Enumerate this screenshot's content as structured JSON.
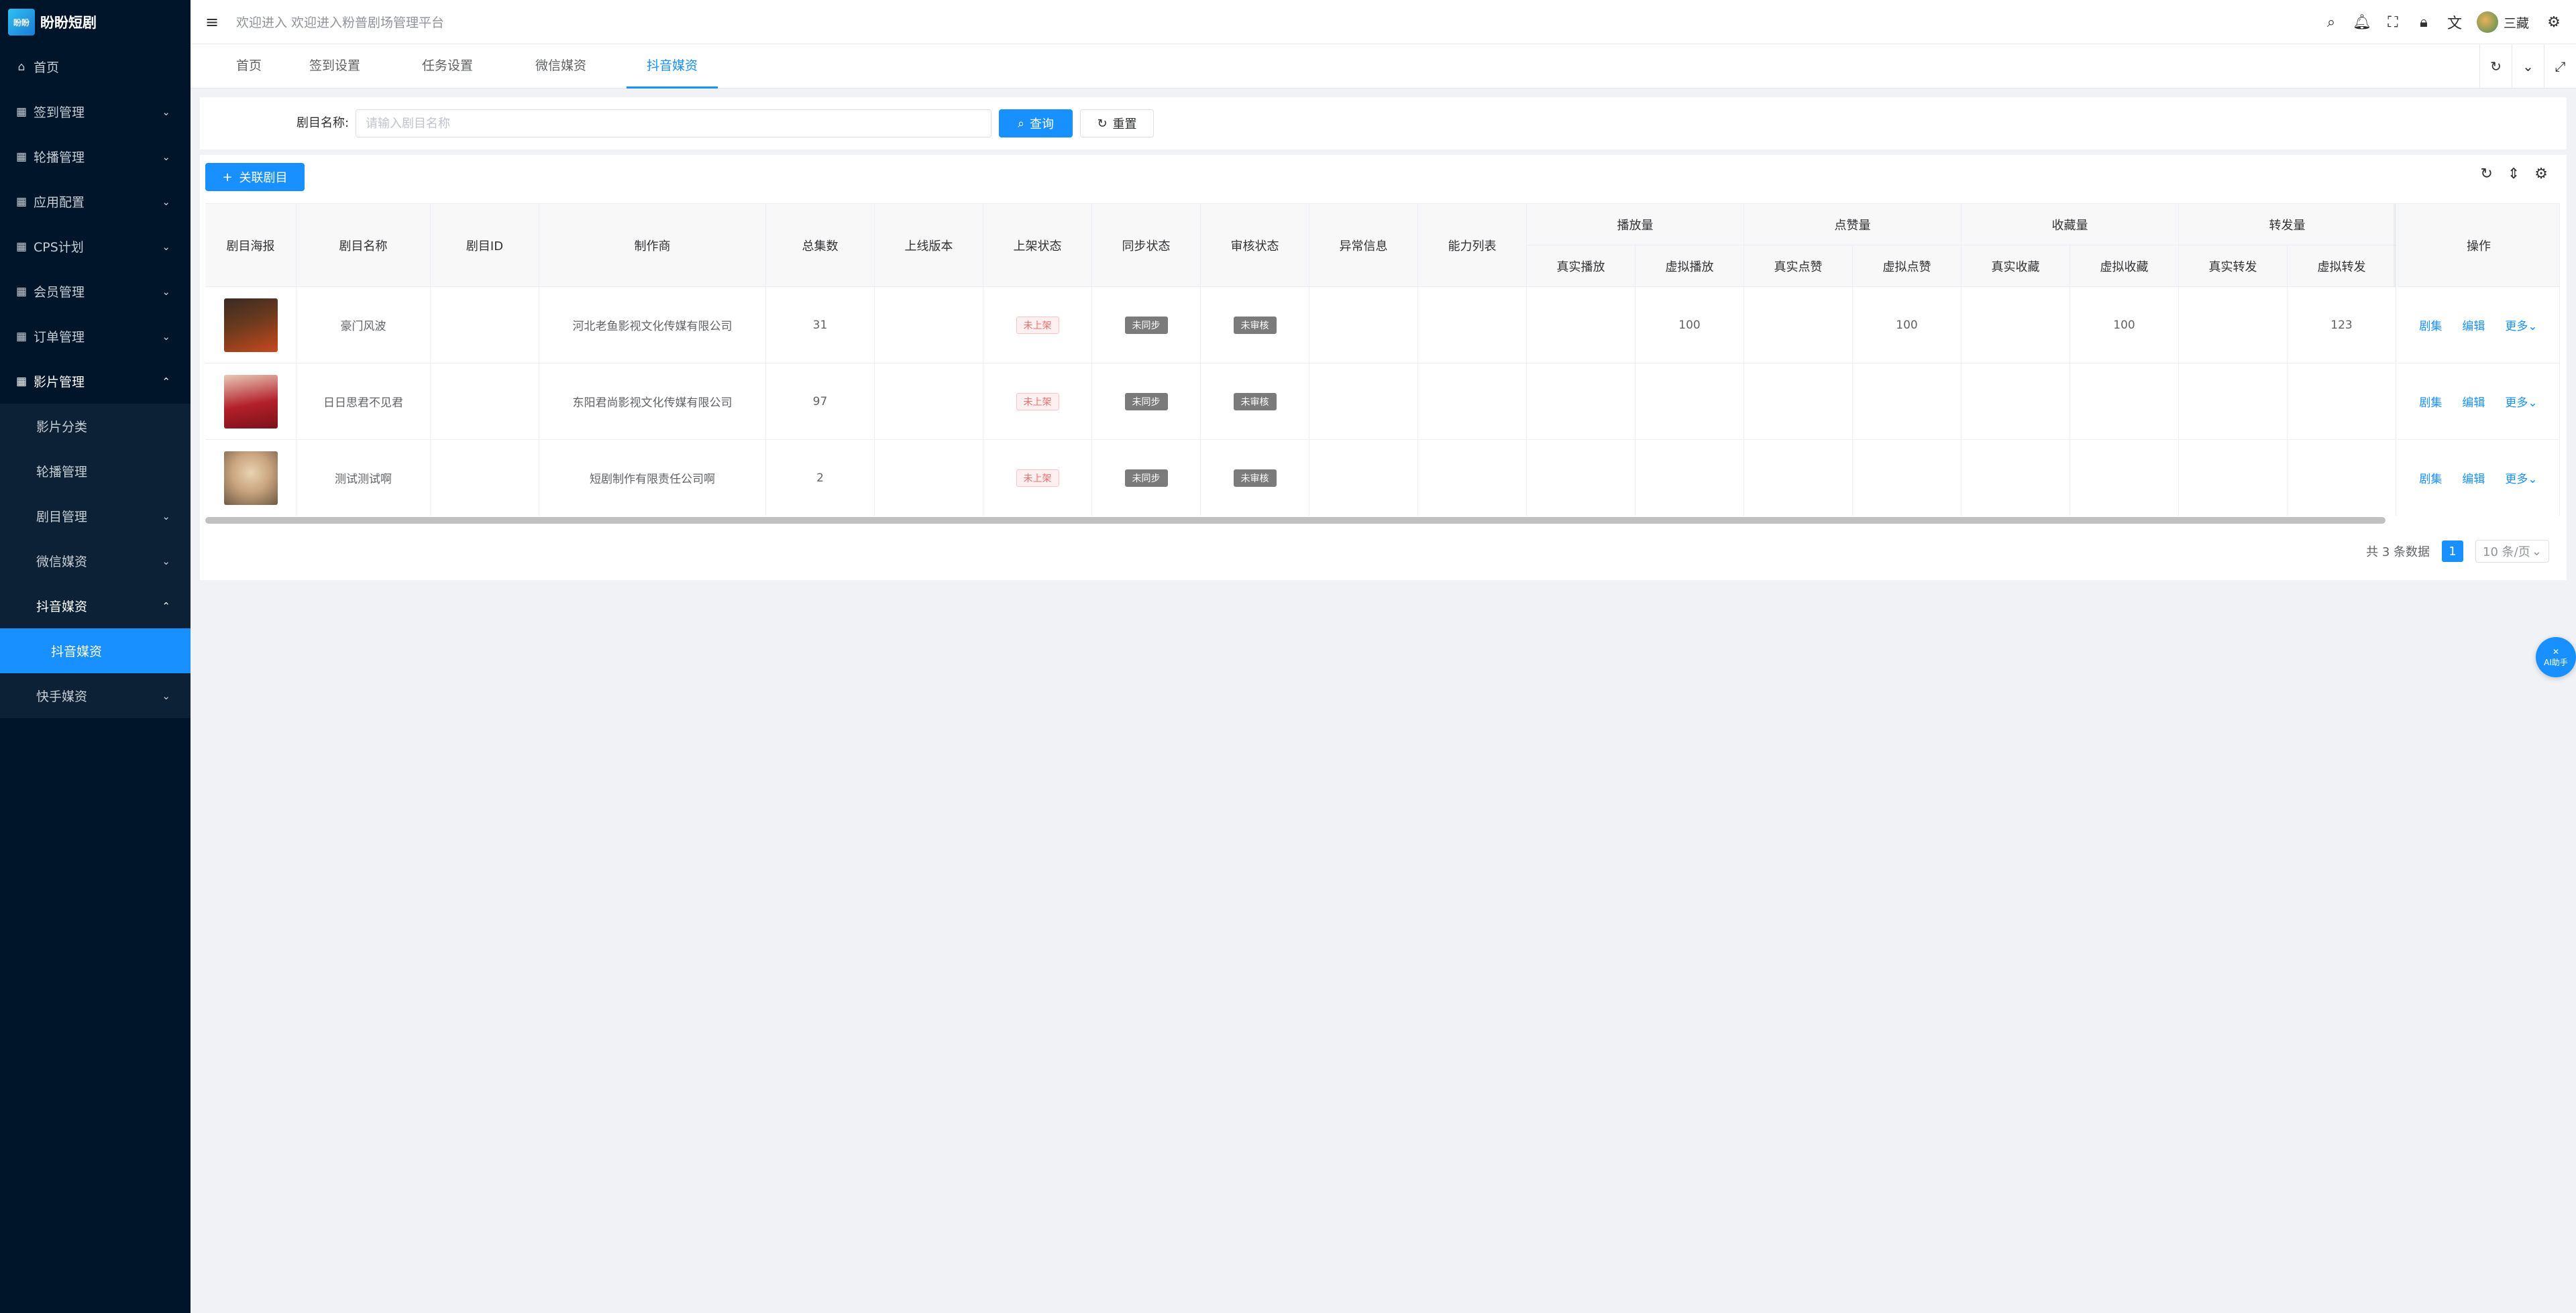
{
  "brand": {
    "logo_glyph": "盼盼",
    "name": "盼盼短剧"
  },
  "sidebar": {
    "items": [
      {
        "label": "首页",
        "icon": "home-icon"
      },
      {
        "label": "签到管理",
        "icon": "grid-icon"
      },
      {
        "label": "轮播管理",
        "icon": "grid-icon"
      },
      {
        "label": "应用配置",
        "icon": "grid-icon"
      },
      {
        "label": "CPS计划",
        "icon": "grid-icon"
      },
      {
        "label": "会员管理",
        "icon": "grid-icon"
      },
      {
        "label": "订单管理",
        "icon": "grid-icon"
      },
      {
        "label": "影片管理",
        "icon": "grid-icon"
      }
    ],
    "film_sub": [
      "影片分类",
      "轮播管理",
      "剧目管理",
      "微信媒资",
      "抖音媒资"
    ],
    "douyin_sub": [
      "抖音媒资"
    ],
    "last_sub": "快手媒资"
  },
  "header": {
    "welcome": "欢迎进入 欢迎进入粉普剧场管理平台",
    "username": "三藏"
  },
  "tabs": [
    "首页",
    "签到设置",
    "任务设置",
    "微信媒资",
    "抖音媒资"
  ],
  "search": {
    "label": "剧目名称:",
    "placeholder": "请输入剧目名称",
    "query_btn": "查询",
    "reset_btn": "重置"
  },
  "toolbar": {
    "add_btn": "关联剧目"
  },
  "table": {
    "headers": {
      "poster": "剧目海报",
      "name": "剧目名称",
      "id": "剧目ID",
      "producer": "制作商",
      "episodes": "总集数",
      "version": "上线版本",
      "shelf": "上架状态",
      "sync": "同步状态",
      "audit": "审核状态",
      "error": "异常信息",
      "ability": "能力列表",
      "plays": "播放量",
      "likes": "点赞量",
      "favs": "收藏量",
      "shares": "转发量",
      "real_play": "真实播放",
      "virtual_play": "虚拟播放",
      "real_like": "真实点赞",
      "virtual_like": "虚拟点赞",
      "real_fav": "真实收藏",
      "virtual_fav": "虚拟收藏",
      "real_share": "真实转发",
      "virtual_share": "虚拟转发",
      "ops": "操作"
    },
    "rows": [
      {
        "name": "豪门风波",
        "producer": "河北老鱼影视文化传媒有限公司",
        "episodes": "31",
        "shelf": "未上架",
        "sync": "未同步",
        "audit": "未审核",
        "virtual_play": "100",
        "virtual_like": "100",
        "virtual_fav": "100",
        "virtual_share": "123",
        "poster_colors": [
          "#3a2a22",
          "#c8491e"
        ]
      },
      {
        "name": "日日思君不见君",
        "producer": "东阳君尚影视文化传媒有限公司",
        "episodes": "97",
        "shelf": "未上架",
        "sync": "未同步",
        "audit": "未审核",
        "virtual_play": "",
        "virtual_like": "",
        "virtual_fav": "",
        "virtual_share": "",
        "poster_colors": [
          "#b3202a",
          "#e8c9b8"
        ]
      },
      {
        "name": "测试测试啊",
        "producer": "短剧制作有限责任公司啊",
        "episodes": "2",
        "shelf": "未上架",
        "sync": "未同步",
        "audit": "未审核",
        "virtual_play": "",
        "virtual_like": "",
        "virtual_fav": "",
        "virtual_share": "",
        "poster_colors": [
          "#caa57f",
          "#6e5a44"
        ]
      }
    ],
    "ops": {
      "episodes": "剧集",
      "edit": "编辑",
      "more": "更多"
    }
  },
  "pagination": {
    "total": "共 3 条数据",
    "page": "1",
    "size": "10 条/页"
  },
  "ai_fab": "AI助手"
}
